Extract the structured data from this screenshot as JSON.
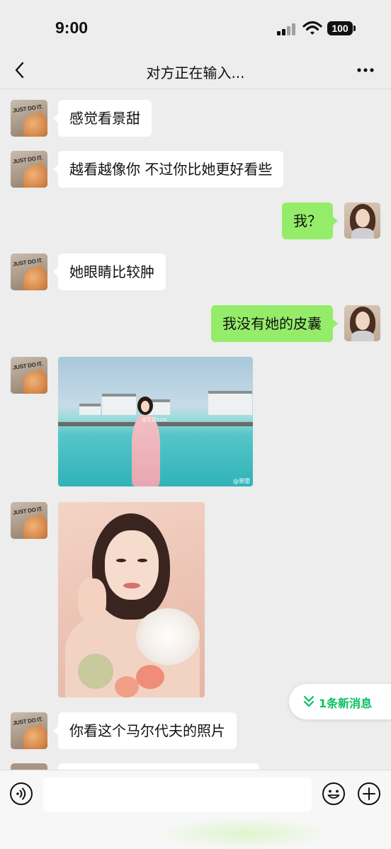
{
  "status_bar": {
    "time": "9:00",
    "battery": "100",
    "signal_icon": "cellular-signal-icon",
    "wifi_icon": "wifi-icon"
  },
  "nav": {
    "back_icon": "chevron-left-icon",
    "title": "对方正在输入...",
    "more_icon": "more-dots-icon"
  },
  "messages": [
    {
      "direction": "in",
      "type": "text",
      "text": "感觉看景甜"
    },
    {
      "direction": "in",
      "type": "text",
      "text": "越看越像你 不过你比她更好看些"
    },
    {
      "direction": "out",
      "type": "text",
      "text": "我？"
    },
    {
      "direction": "in",
      "type": "text",
      "text": "她眼睛比较肿"
    },
    {
      "direction": "out",
      "type": "text",
      "text": "我没有她的皮囊"
    },
    {
      "direction": "in",
      "type": "image",
      "description_icon": "photo-sea-villa",
      "watermark": "@景甜",
      "overlay_text": "@写真SUN"
    },
    {
      "direction": "in",
      "type": "image",
      "description_icon": "photo-portrait"
    },
    {
      "direction": "in",
      "type": "text",
      "text": "你看这个马尔代夫的照片"
    }
  ],
  "new_messages_pill": {
    "icon": "double-chevron-down-icon",
    "label": "1条新消息"
  },
  "input_bar": {
    "voice_icon": "voice-icon",
    "input_value": "",
    "emoji_icon": "emoji-icon",
    "plus_icon": "plus-icon"
  },
  "colors": {
    "accent": "#07c160",
    "outgoing_bubble": "#95ec69",
    "incoming_bubble": "#ffffff",
    "background": "#ededed"
  }
}
